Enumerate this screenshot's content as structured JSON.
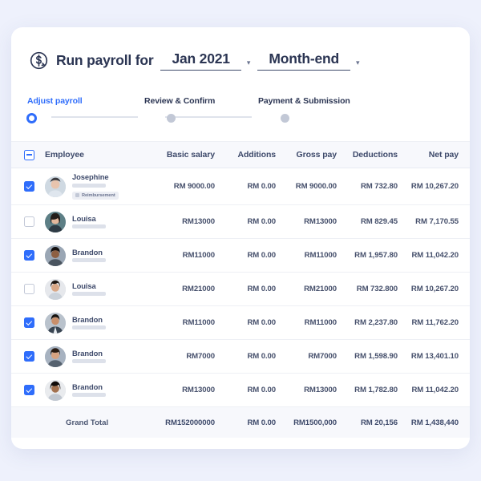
{
  "header": {
    "icon": "payroll-dollar-refresh-icon",
    "title": "Run payroll for",
    "period": {
      "value": "Jan 2021",
      "caret": "▾"
    },
    "cycle": {
      "value": "Month-end",
      "caret": "▾"
    }
  },
  "stepper": {
    "steps": [
      {
        "label": "Adjust payroll",
        "state": "active"
      },
      {
        "label": "Review & Confirm",
        "state": "upcoming"
      },
      {
        "label": "Payment & Submission",
        "state": "upcoming"
      }
    ],
    "active_color": "#2f6dfb",
    "inactive_color": "#c2c8d6"
  },
  "table": {
    "select_all_state": "indeterminate",
    "columns": [
      "Employee",
      "Basic salary",
      "Additions",
      "Gross pay",
      "Deductions",
      "Net pay"
    ],
    "rows": [
      {
        "checked": true,
        "name": "Josephine",
        "badge": "Reimbursement",
        "basic_salary": "RM 9000.00",
        "additions": "RM 0.00",
        "gross_pay": "RM 9000.00",
        "deductions": "RM 732.80",
        "net_pay": "RM 10,267.20"
      },
      {
        "checked": false,
        "name": "Louisa",
        "basic_salary": "RM13000",
        "additions": "RM 0.00",
        "gross_pay": "RM13000",
        "deductions": "RM 829.45",
        "net_pay": "RM 7,170.55"
      },
      {
        "checked": true,
        "name": "Brandon",
        "basic_salary": "RM11000",
        "additions": "RM 0.00",
        "gross_pay": "RM11000",
        "deductions": "RM 1,957.80",
        "net_pay": "RM 11,042.20"
      },
      {
        "checked": false,
        "name": "Louisa",
        "basic_salary": "RM21000",
        "additions": "RM 0.00",
        "gross_pay": "RM21000",
        "deductions": "RM 732.800",
        "net_pay": "RM 10,267.20"
      },
      {
        "checked": true,
        "name": "Brandon",
        "basic_salary": "RM11000",
        "additions": "RM 0.00",
        "gross_pay": "RM11000",
        "deductions": "RM 2,237.80",
        "net_pay": "RM 11,762.20"
      },
      {
        "checked": true,
        "name": "Brandon",
        "basic_salary": "RM7000",
        "additions": "RM 0.00",
        "gross_pay": "RM7000",
        "deductions": "RM 1,598.90",
        "net_pay": "RM 13,401.10"
      },
      {
        "checked": true,
        "name": "Brandon",
        "basic_salary": "RM13000",
        "additions": "RM 0.00",
        "gross_pay": "RM13000",
        "deductions": "RM 1,782.80",
        "net_pay": "RM 11,042.20"
      }
    ],
    "grand_total": {
      "label": "Grand Total",
      "basic_salary": "RM152000000",
      "additions": "RM 0.00",
      "gross_pay": "RM1500,000",
      "deductions": "RM 20,156",
      "net_pay": "RM 1,438,440"
    }
  }
}
